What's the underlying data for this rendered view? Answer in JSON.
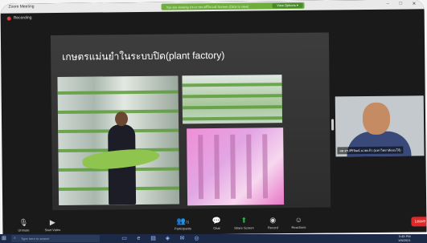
{
  "window": {
    "title": "Zoom Meeting",
    "controls": [
      "–",
      "□",
      "✕"
    ]
  },
  "banner": {
    "text": "You are viewing ประภาพร ศรีไพวงษ์ Screen (Click to view)",
    "options_label": "View Options ▾"
  },
  "recording": {
    "label": "Recording"
  },
  "slide": {
    "title": "เกษตรแม่นยำในระบบปิด(plant factory)"
  },
  "participant": {
    "name": "ผศ.ดร.ศิริวัฒน์ นวลแก้ว (มหาวิทยาลัยแม่โจ้)"
  },
  "toolbar": {
    "mute": "Unmute",
    "video": "Start Video",
    "participants": "Participants",
    "participants_count": "72",
    "chat": "Chat",
    "share": "Share Screen",
    "record": "Record",
    "reactions": "Reactions",
    "leave": "Leave"
  },
  "taskbar": {
    "search_placeholder": "Type here to search",
    "time": "3:45 PM",
    "date": "1/5/2021"
  },
  "colors": {
    "accent_green": "#2eb84b",
    "banner_green": "#6fae3e",
    "leave_red": "#e02828",
    "recording_red": "#e23b3b"
  },
  "icons": [
    "microphone-icon",
    "video-camera-icon",
    "participants-icon",
    "chat-icon",
    "share-screen-icon",
    "record-icon",
    "reactions-icon",
    "windows-start-icon",
    "search-icon"
  ]
}
